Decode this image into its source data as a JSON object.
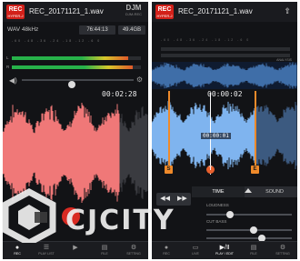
{
  "left_screen": {
    "rec_badge": {
      "title": "REC",
      "subtitle": "HYPER-J"
    },
    "filename": "REC_20171121_1.wav",
    "brand": {
      "title": "DJM",
      "subtitle": "DJM-REC"
    },
    "format": "WAV 48kHz",
    "remaining_time": "76:44:13",
    "free_space": "49.4GB",
    "meter_scale": "-60 -48 -36 -24 -18 -12 -6 0",
    "channels": {
      "left": "L",
      "right": "R"
    },
    "meter_levels": {
      "left": 0.9,
      "right": 0.94
    },
    "volume_level": 0.45,
    "elapsed": "00:02:28",
    "waveform_color": "#f07878",
    "tabs": [
      {
        "label": "REC",
        "icon": "record-icon",
        "glyph": "●"
      },
      {
        "label": "PLAY LIST",
        "icon": "list-icon",
        "glyph": "☰"
      },
      {
        "label": "",
        "icon": "play-pause-icon",
        "glyph": "▶"
      },
      {
        "label": "FILE",
        "icon": "file-icon",
        "glyph": "▤"
      },
      {
        "label": "SETTING",
        "icon": "gear-icon",
        "glyph": "⚙"
      }
    ]
  },
  "right_screen": {
    "rec_badge": {
      "title": "REC",
      "subtitle": "HYPER-J"
    },
    "filename": "REC_20171121_1.wav",
    "brand_icon": "share-icon",
    "analysis_label": "ANALYSIS",
    "playhead_time": "00:00:02",
    "marker_time": "00:00:01",
    "markers": {
      "start": "S",
      "center": "T",
      "end": "E"
    },
    "waveform_color": "#7fb4ef",
    "panel_tabs": [
      {
        "label": "TIME",
        "active": true
      },
      {
        "label": "SOUND",
        "active": false
      }
    ],
    "transport_buttons": [
      {
        "name": "rewind",
        "glyph": "◀◀"
      },
      {
        "name": "forward",
        "glyph": "▶▶"
      }
    ],
    "labels": {
      "loudness": "LOUDNESS",
      "cut_bass": "CUT BASS"
    },
    "slider_levels": {
      "loudness": 0.28,
      "cut_bass": 0.55,
      "third": 0.65
    },
    "tabs": [
      {
        "label": "REC",
        "icon": "record-icon",
        "glyph": "●"
      },
      {
        "label": "LIVE",
        "icon": "live-icon",
        "glyph": "▭"
      },
      {
        "label": "PLAY / EDIT",
        "icon": "play-pause-icon",
        "glyph": "▶/Ⅱ"
      },
      {
        "label": "FILE",
        "icon": "file-icon",
        "glyph": "▤"
      },
      {
        "label": "SETTING",
        "icon": "gear-icon",
        "glyph": "⚙"
      }
    ]
  },
  "watermark": {
    "text": "CJCITY",
    "logo": "cjcity-logo"
  }
}
